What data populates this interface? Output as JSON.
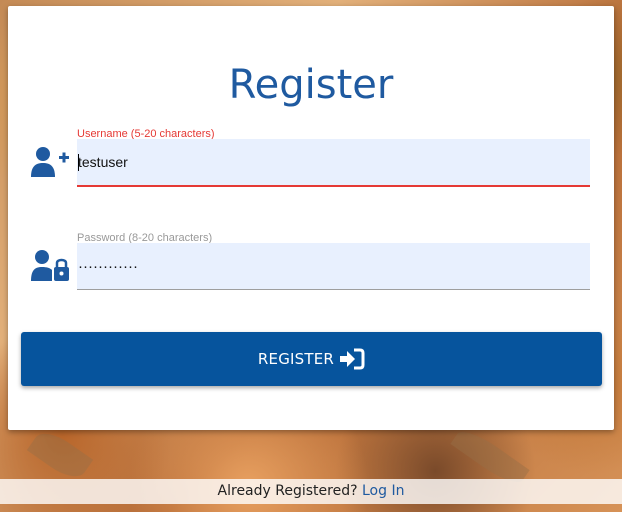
{
  "page": {
    "title": "Register"
  },
  "username": {
    "label": "Username (5-20 characters)",
    "value": "testuser",
    "label_color": "#e53935",
    "underline_color": "#e53935",
    "icon": "user-plus-icon"
  },
  "password": {
    "label": "Password (8-20 characters)",
    "value": "············",
    "label_color": "#999999",
    "underline_color": "#9e9e9e",
    "icon": "user-lock-icon"
  },
  "register_button": {
    "label": "REGISTER",
    "icon": "sign-in-icon",
    "color": "#06549d"
  },
  "footer": {
    "text": "Already Registered?",
    "link": "Log In"
  },
  "colors": {
    "accent": "#1f5aa0",
    "field_bg": "#e8f0fe"
  }
}
